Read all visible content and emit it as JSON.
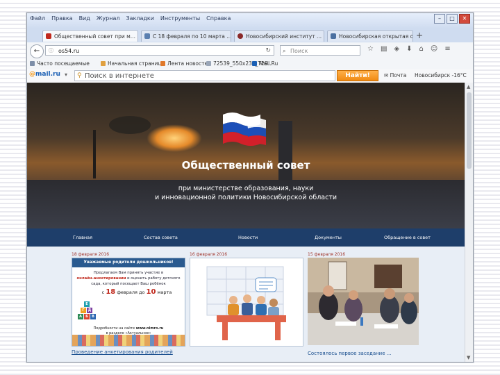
{
  "browser": {
    "menu": [
      "Файл",
      "Правка",
      "Вид",
      "Журнал",
      "Закладки",
      "Инструменты",
      "Справка"
    ],
    "tabs": [
      {
        "label": "Общественный совет при м...",
        "active": true,
        "color": "#c0281c"
      },
      {
        "label": "С 18 февраля по 10 марта ...",
        "active": false,
        "color": "#5a7fb0"
      },
      {
        "label": "Новосибирский институт ...",
        "active": false,
        "color": "#8a2a2a"
      },
      {
        "label": "Новосибирская открытая о...",
        "active": false,
        "color": "#4a6fa0"
      }
    ],
    "url": "os54.ru",
    "search_placeholder": "Поиск",
    "bookmarks": [
      "Часто посещаемые",
      "Начальная страница",
      "Лента новостей",
      "72539_550x234_T29...",
      "Mail.Ru"
    ],
    "mailbar": {
      "logo_prefix": "@",
      "logo_text": "mail.ru",
      "search_placeholder": "Поиск в интернете",
      "find_button": "Найти!",
      "mail_link": "Почта",
      "weather": "Новосибирск -16°C"
    }
  },
  "site": {
    "title": "Общественный совет",
    "subtitle_line1": "при министерстве образования, науки",
    "subtitle_line2": "и инновационной политики Новосибирской области",
    "nav": [
      "Главная",
      "Состав совета",
      "Новости",
      "Документы",
      "Обращение в совет"
    ],
    "news": [
      {
        "date": "18 февраля 2016",
        "card_header": "Уважаемые родители дошкольников!",
        "line1": "Предлагаем Вам принять участие в",
        "line2_red": "онлайн-анкетировании",
        "line2_rest": " и оценить работу детского",
        "line3": "сада, который посещает Ваш ребёнок",
        "dates_prefix": "с",
        "date_from_num": "18",
        "date_from_month": "февраля",
        "dates_mid": "до",
        "date_to_num": "10",
        "date_to_month": "марта",
        "more_line1_prefix": "Подробности на сайте",
        "more_site": "www.nimro.ru",
        "more_line2": "в разделе «Актуальное»",
        "link": "Проведение анкетирования родителей"
      },
      {
        "date": "16 февраля 2016"
      },
      {
        "date": "15 февраля 2016",
        "link": "Состоялось первое заседание ..."
      }
    ]
  }
}
